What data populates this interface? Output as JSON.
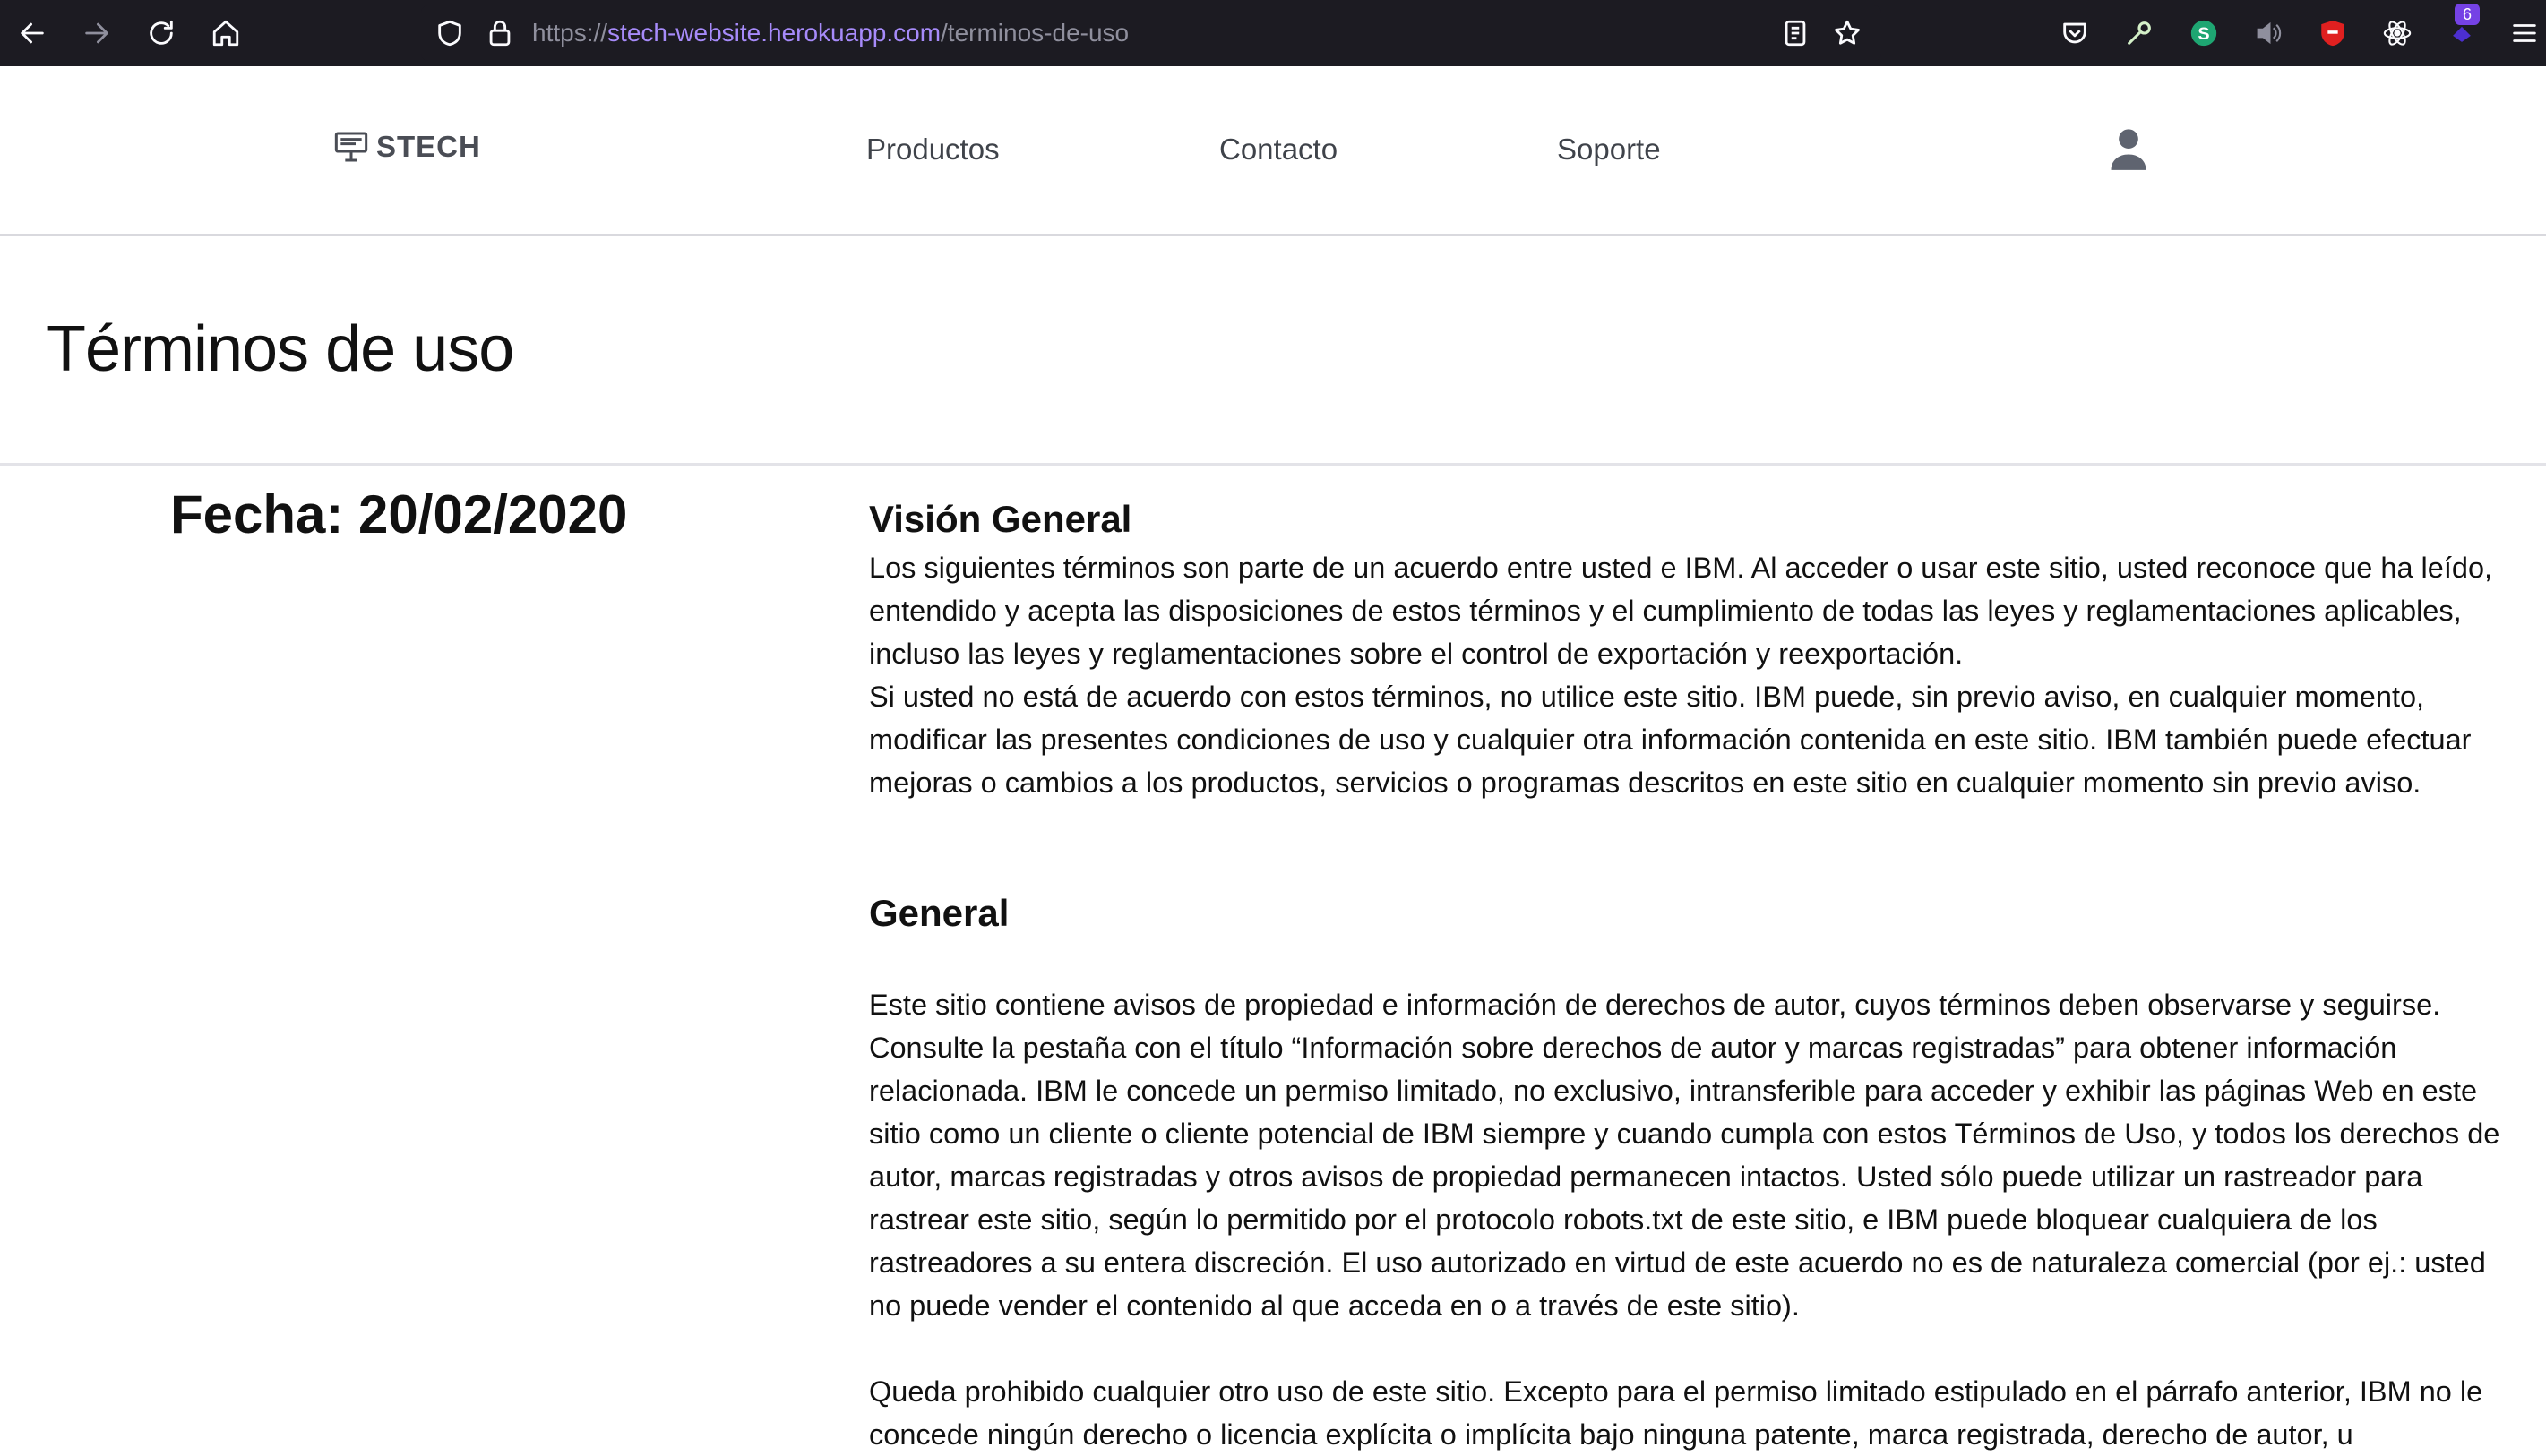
{
  "browser": {
    "url": {
      "scheme": "https://",
      "host": "stech-website.herokuapp.com",
      "path": "/terminos-de-uso"
    },
    "extension_badge_count": "6",
    "icons": [
      "back-icon",
      "forward-icon",
      "reload-icon",
      "home-icon",
      "shield-icon",
      "lock-icon",
      "reader-view-icon",
      "bookmark-star-icon",
      "pocket-icon",
      "wrench-icon",
      "s-extension-icon",
      "speaker-icon",
      "ublock-icon",
      "react-devtools-icon",
      "extensions-icon",
      "menu-icon"
    ]
  },
  "header": {
    "logo_text": "STECH",
    "nav": [
      {
        "label": "Productos"
      },
      {
        "label": "Contacto"
      },
      {
        "label": "Soporte"
      }
    ],
    "user_icon": "user-icon"
  },
  "page": {
    "title": "Términos de uso",
    "date": "Fecha: 20/02/2020"
  },
  "sections": [
    {
      "heading": "Visión General",
      "paragraphs": [
        "Los siguientes términos son parte de un acuerdo entre usted e IBM. Al acceder o usar este sitio, usted reconoce que ha leído, entendido y acepta las disposiciones de estos términos y el cumplimiento de todas las leyes y reglamentaciones aplicables, incluso las leyes y reglamentaciones sobre el control de exportación y reexportación.",
        "Si usted no está de acuerdo con estos términos, no utilice este sitio. IBM puede, sin previo aviso, en cualquier momento, modificar las presentes condiciones de uso y cualquier otra información contenida en este sitio. IBM también puede efectuar mejoras o cambios a los productos, servicios o programas descritos en este sitio en cualquier momento sin previo aviso."
      ]
    },
    {
      "heading": "General",
      "paragraphs": [
        "Este sitio contiene avisos de propiedad e información de derechos de autor, cuyos términos deben observarse y seguirse. Consulte la pestaña con el título “Información sobre derechos de autor y marcas registradas” para obtener información relacionada. IBM le concede un permiso limitado, no exclusivo, intransferible para acceder y exhibir las páginas Web en este sitio como un cliente o cliente potencial de IBM siempre y cuando cumpla con estos Términos de Uso, y todos los derechos de autor, marcas registradas y otros avisos de propiedad permanecen intactos. Usted sólo puede utilizar un rastreador para rastrear este sitio, según lo permitido por el protocolo robots.txt de este sitio, e IBM puede bloquear cualquiera de los rastreadores a su entera discreción. El uso autorizado en virtud de este acuerdo no es de naturaleza comercial (por ej.: usted no puede vender el contenido al que acceda en o a través de este sitio).",
        "Queda prohibido cualquier otro uso de este sitio. Excepto para el permiso limitado estipulado en el párrafo anterior, IBM no le concede ningún derecho o licencia explícita o implícita bajo ninguna patente, marca registrada, derecho de autor, u"
      ]
    }
  ],
  "colors": {
    "browser_bar": "#1c1b22",
    "url_host": "#a78bfa",
    "header_divider": "#d9d9de",
    "nav_text": "#3f434a"
  }
}
